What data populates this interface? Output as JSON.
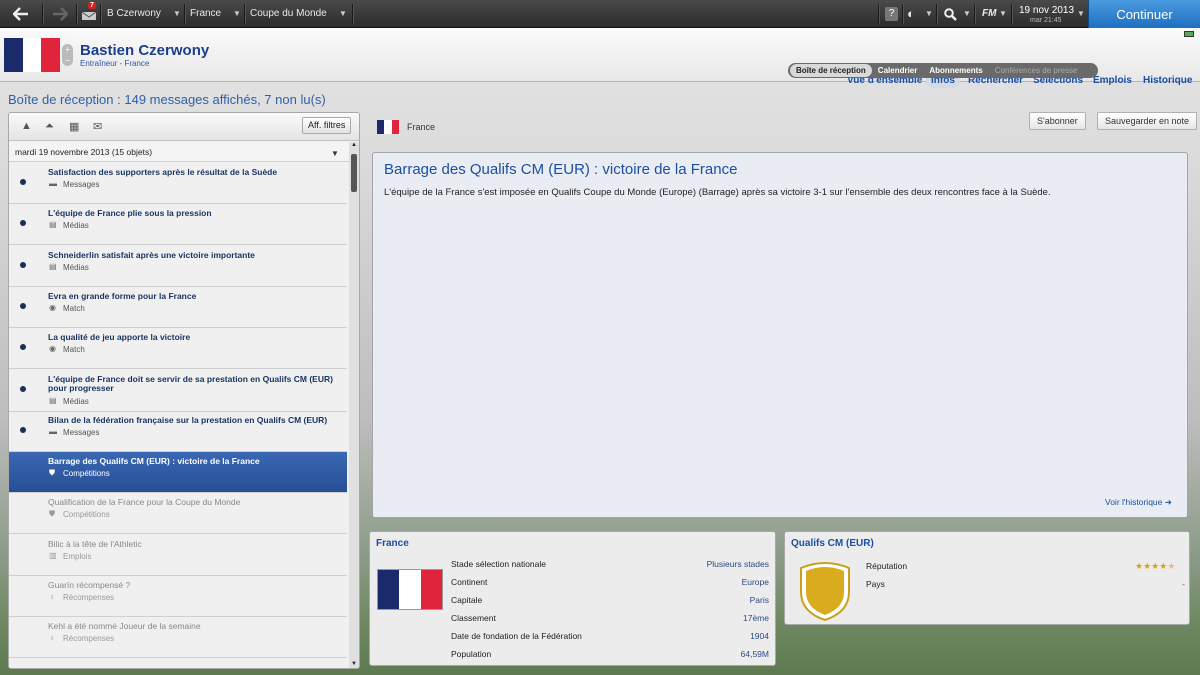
{
  "topbar": {
    "mail_badge": "7",
    "breadcrumb": [
      "B Czerwony",
      "France",
      "Coupe du Monde"
    ],
    "fm_label": "FM",
    "date": "19 nov 2013",
    "time": "mar 21:45",
    "continue_label": "Continuer",
    "help_label": "?"
  },
  "header": {
    "manager_name": "Bastien Czerwony",
    "manager_role": "Entraîneur - France",
    "nav": [
      "Vue d'ensemble",
      "Infos",
      "Rechercher",
      "Sélections",
      "Emplois",
      "Historique"
    ],
    "subnav": [
      "Boîte de réception",
      "Calendrier",
      "Abonnements",
      "Conférences de presse"
    ]
  },
  "inbox": {
    "title": "Boîte de réception : 149 messages affichés, 7 non lu(s)",
    "filter_label": "Aff. filtres",
    "date_header": "mardi 19 novembre 2013 (15 objets)",
    "messages": [
      {
        "title": "Satisfaction des supporters après le résultat de la Suède",
        "category": "Messages",
        "icon": "message-icon"
      },
      {
        "title": "L'équipe de France plie sous la pression",
        "category": "Médias",
        "icon": "newspaper-icon"
      },
      {
        "title": "Schneiderlin satisfait après une victoire importante",
        "category": "Médias",
        "icon": "newspaper-icon"
      },
      {
        "title": "Evra en grande forme pour la France",
        "category": "Match",
        "icon": "ball-icon"
      },
      {
        "title": "La qualité de jeu apporte la victoire",
        "category": "Match",
        "icon": "ball-icon"
      },
      {
        "title": "L'équipe de France doit se servir de sa prestation en Qualifs CM (EUR) pour progresser",
        "category": "Médias",
        "icon": "newspaper-icon"
      },
      {
        "title": "Bilan de la fédération française sur la prestation en Qualifs CM (EUR)",
        "category": "Messages",
        "icon": "message-icon"
      },
      {
        "title": "Barrage des Qualifs CM (EUR) : victoire de la France",
        "category": "Compétitions",
        "icon": "shield-icon"
      },
      {
        "title": "Qualification de la France pour la Coupe du Monde",
        "category": "Compétitions",
        "icon": "shield-icon"
      },
      {
        "title": "Bilic à la tête de l'Athletic",
        "category": "Emplois",
        "icon": "building-icon"
      },
      {
        "title": "Guarín récompensé ?",
        "category": "Récompenses",
        "icon": "trophy-icon"
      },
      {
        "title": "Kehl a été nommé Joueur de la semaine",
        "category": "Récompenses",
        "icon": "trophy-icon"
      }
    ]
  },
  "article": {
    "country": "France",
    "subscribe_label": "S'abonner",
    "save_label": "Sauvegarder en note",
    "title": "Barrage des Qualifs CM (EUR) : victoire de la France",
    "body": "L'équipe de la France s'est imposée en Qualifs Coupe du Monde (Europe) (Barrage) après sa victoire 3-1 sur l'ensemble des deux rencontres face à la Suède.",
    "history_link": "Voir l'historique"
  },
  "france_card": {
    "title": "France",
    "rows": [
      {
        "label": "Stade sélection nationale",
        "value": "Plusieurs stades"
      },
      {
        "label": "Continent",
        "value": "Europe"
      },
      {
        "label": "Capitale",
        "value": "Paris"
      },
      {
        "label": "Classement",
        "value": "17ème"
      },
      {
        "label": "Date de fondation de la Fédération",
        "value": "1904"
      },
      {
        "label": "Population",
        "value": "64,59M"
      }
    ]
  },
  "comp_card": {
    "title": "Qualifs CM (EUR)",
    "reputation_label": "Réputation",
    "reputation_stars": 4.5,
    "country_label": "Pays",
    "country_value": "-"
  },
  "colors": {
    "accent": "#1c4fa0",
    "continue": "#2d7fd0",
    "selected": "#2e5aa2"
  }
}
